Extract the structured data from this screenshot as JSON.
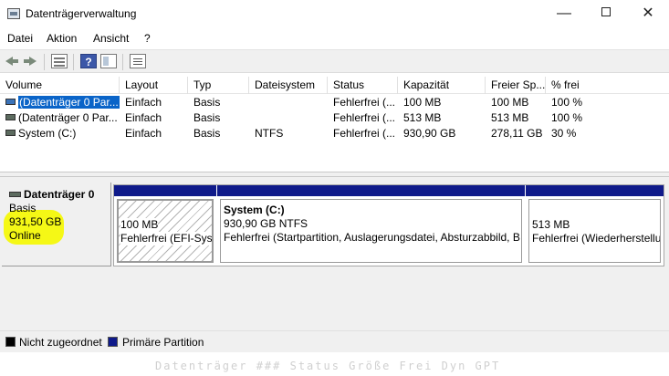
{
  "window": {
    "title": "Datenträgerverwaltung",
    "minimize_glyph": "—",
    "close_glyph": "✕"
  },
  "menu": [
    "Datei",
    "Aktion",
    "Ansicht",
    "?"
  ],
  "toolbar": {
    "help_glyph": "?"
  },
  "columns": [
    "Volume",
    "Layout",
    "Typ",
    "Dateisystem",
    "Status",
    "Kapazität",
    "Freier Sp...",
    "% frei"
  ],
  "volumes": [
    {
      "volume": "(Datenträger 0 Par...",
      "layout": "Einfach",
      "typ": "Basis",
      "dateisystem": "",
      "status": "Fehlerfrei (...",
      "kapazitaet": "100 MB",
      "frei": "100 MB",
      "prozent": "100 %"
    },
    {
      "volume": "(Datenträger 0 Par...",
      "layout": "Einfach",
      "typ": "Basis",
      "dateisystem": "",
      "status": "Fehlerfrei (...",
      "kapazitaet": "513 MB",
      "frei": "513 MB",
      "prozent": "100 %"
    },
    {
      "volume": "System (C:)",
      "layout": "Einfach",
      "typ": "Basis",
      "dateisystem": "NTFS",
      "status": "Fehlerfrei (...",
      "kapazitaet": "930,90 GB",
      "frei": "278,11 GB",
      "prozent": "30 %"
    }
  ],
  "disk": {
    "name": "Datenträger 0",
    "type": "Basis",
    "size": "931,50 GB",
    "state": "Online",
    "partitions": [
      {
        "name": "",
        "size": "100 MB",
        "status": "Fehlerfrei (EFI-Syst"
      },
      {
        "name": "System  (C:)",
        "size": "930,90 GB NTFS",
        "status": "Fehlerfrei (Startpartition, Auslagerungsdatei, Absturzabbild, B"
      },
      {
        "name": "",
        "size": "513 MB",
        "status": "Fehlerfrei (Wiederherstellu"
      }
    ]
  },
  "legend": [
    {
      "label": "Nicht zugeordnet",
      "color": "#000000"
    },
    {
      "label": "Primäre Partition",
      "color": "#0f1a8a"
    }
  ],
  "background_text": "Datenträger ###  Status          Größe     Frei    Dyn  GPT"
}
